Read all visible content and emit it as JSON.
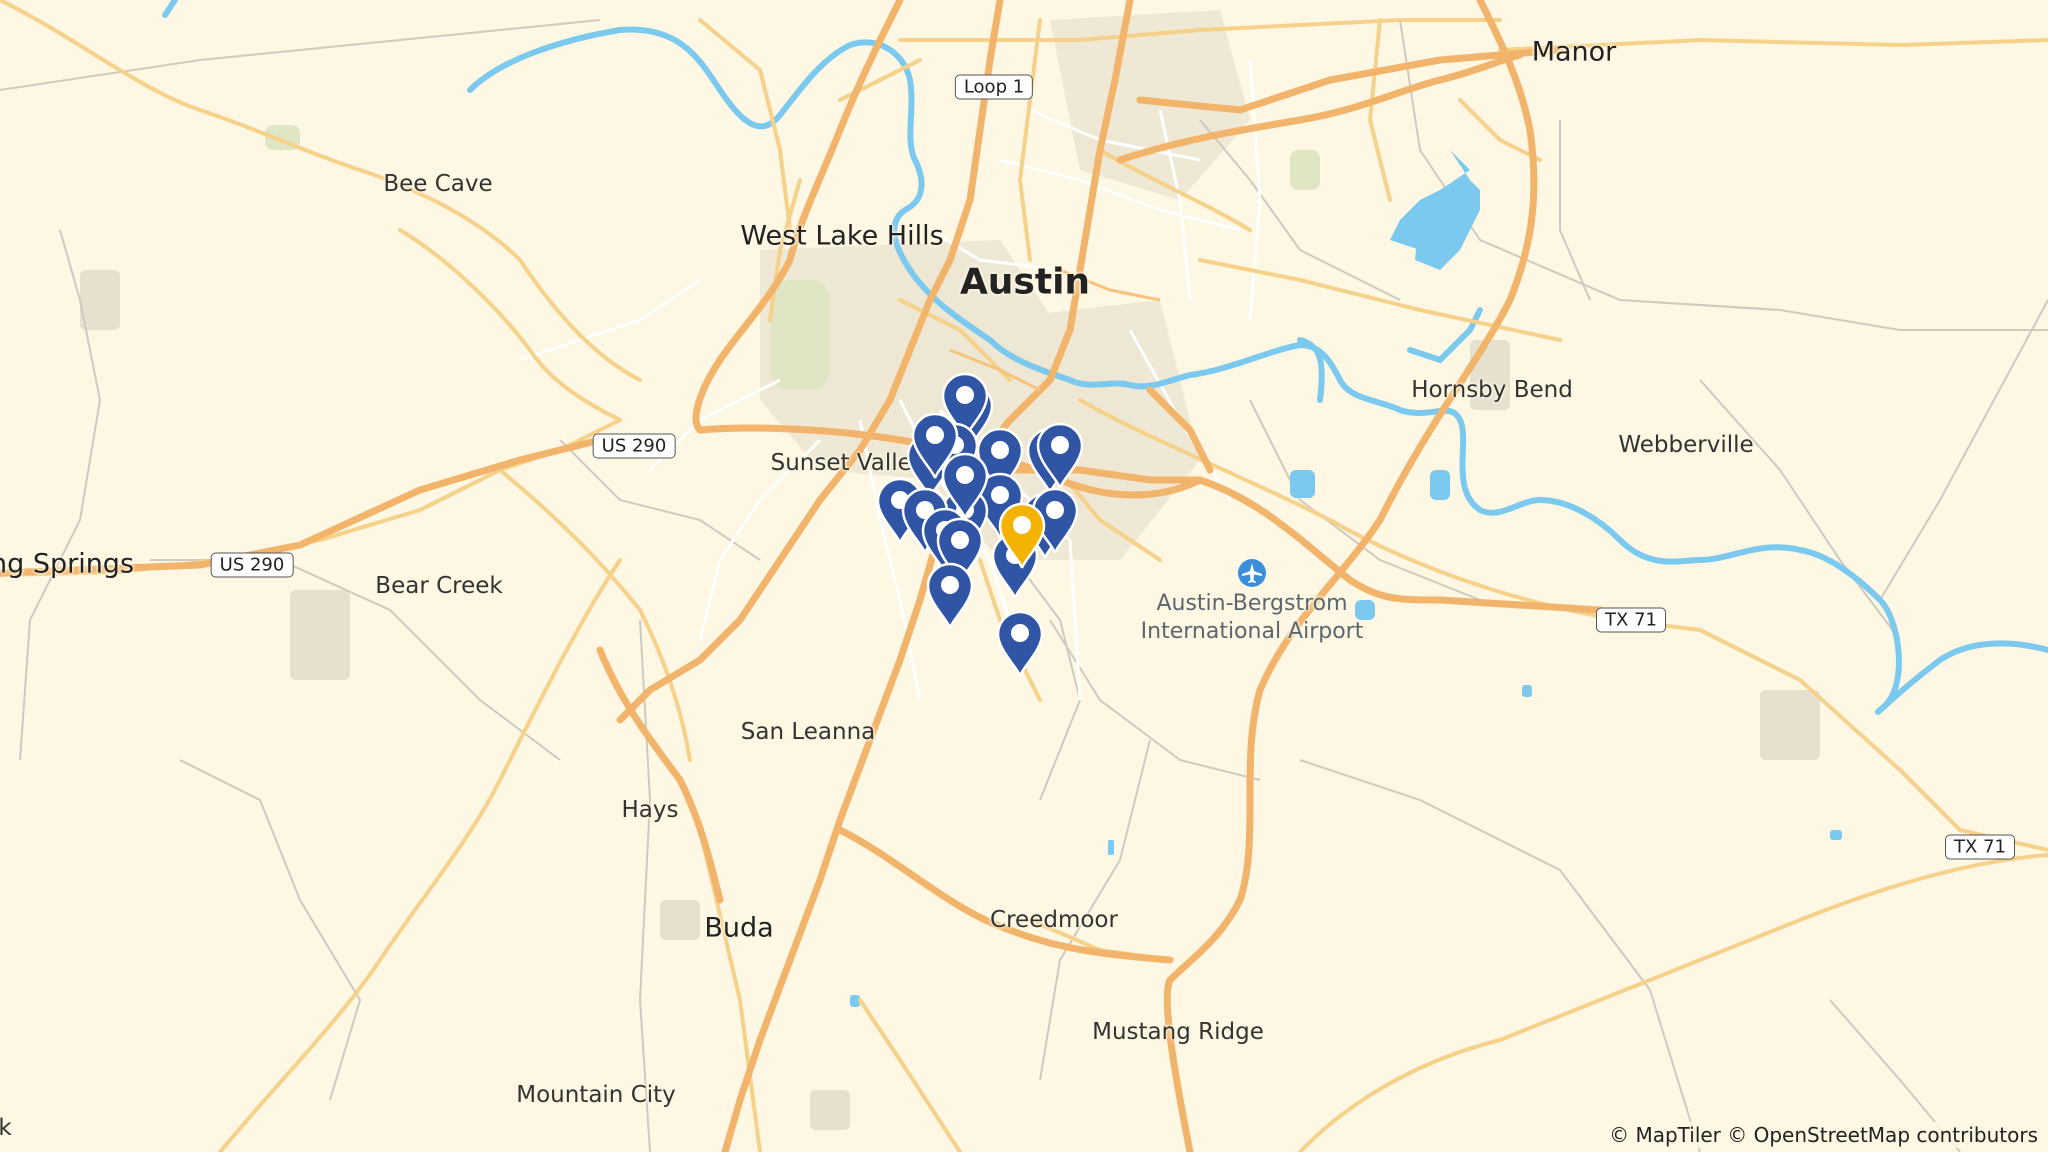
{
  "map": {
    "towns": [
      {
        "name": "Manor",
        "cls": "cityb"
      },
      {
        "name": "Bee Cave",
        "cls": "town"
      },
      {
        "name": "West Lake Hills",
        "cls": "cityb"
      },
      {
        "name": "Austin",
        "cls": "city"
      },
      {
        "name": "Hornsby Bend",
        "cls": "town"
      },
      {
        "name": "Webberville",
        "cls": "town"
      },
      {
        "name": "Sunset Valley",
        "cls": "town"
      },
      {
        "name": "ng Springs",
        "cls": "cityb"
      },
      {
        "name": "Bear Creek",
        "cls": "town"
      },
      {
        "name": "San Leanna",
        "cls": "town"
      },
      {
        "name": "Hays",
        "cls": "town"
      },
      {
        "name": "Buda",
        "cls": "cityb"
      },
      {
        "name": "Creedmoor",
        "cls": "town"
      },
      {
        "name": "Mustang Ridge",
        "cls": "town"
      },
      {
        "name": "Mountain City",
        "cls": "town"
      },
      {
        "name": "k",
        "cls": "town"
      }
    ],
    "airport": {
      "line1": "Austin-Bergstrom",
      "line2": "International Airport",
      "icon": "airplane-icon"
    },
    "shields": [
      "Loop 1",
      "US 290",
      "US 290",
      "TX 71",
      "TX 71"
    ],
    "markers": {
      "blue_color": "#2f55a4",
      "highlight_color": "#f5b301",
      "count_blue": 20,
      "count_highlight": 1
    },
    "attribution": "© MapTiler © OpenStreetMap contributors"
  }
}
